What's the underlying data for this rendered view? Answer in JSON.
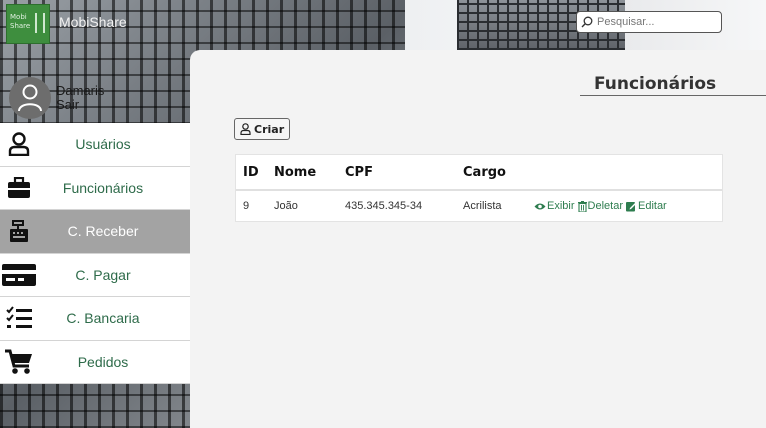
{
  "header": {
    "logo_text": "Mobi Share",
    "app_name": "MobiShare",
    "search": {
      "placeholder": "Pesquisar...",
      "value": ""
    }
  },
  "user": {
    "name": "Damaris",
    "logout_label": "Sair"
  },
  "sidebar": {
    "items": [
      {
        "label": "Usuários",
        "icon": "user-icon",
        "active": false
      },
      {
        "label": "Funcionários",
        "icon": "briefcase-icon",
        "active": false
      },
      {
        "label": "C. Receber",
        "icon": "cash-register-icon",
        "active": true
      },
      {
        "label": "C. Pagar",
        "icon": "credit-card-icon",
        "active": false
      },
      {
        "label": "C. Bancaria",
        "icon": "checklist-icon",
        "active": false
      },
      {
        "label": "Pedidos",
        "icon": "cart-icon",
        "active": false
      }
    ]
  },
  "main": {
    "title": "Funcionários",
    "create_label": "Criar",
    "table": {
      "headers": [
        "ID",
        "Nome",
        "CPF",
        "Cargo"
      ],
      "rows": [
        {
          "id": "9",
          "nome": "João",
          "cpf": "435.345.345-34",
          "cargo": "Acrilista"
        }
      ],
      "actions": {
        "view": "Exibir",
        "delete": "Deletar",
        "edit": "Editar"
      }
    }
  },
  "colors": {
    "accent_green": "#2e7d4f",
    "active_menu": "#a3a3a3",
    "logo_green": "#3e8e3e"
  }
}
